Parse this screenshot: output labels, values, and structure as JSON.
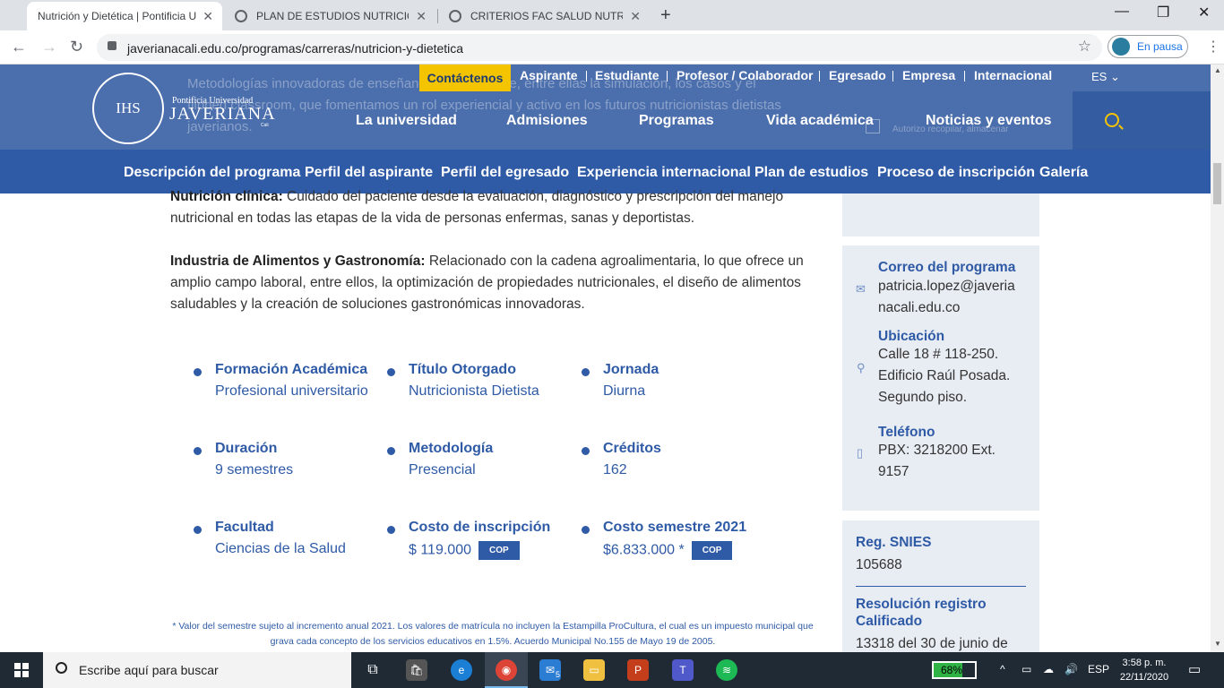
{
  "browser": {
    "tabs": [
      {
        "title": "Nutrición y Dietética | Pontificia U"
      },
      {
        "title": "PLAN DE ESTUDIOS NUTRICION"
      },
      {
        "title": "CRITERIOS FAC SALUD NUTRICIO"
      }
    ],
    "url": "javerianacali.edu.co/programas/carreras/nutricion-y-dietetica",
    "profile_label": "En pausa"
  },
  "header": {
    "ghost_text": "Metodologías innovadoras de enseñanza y aprendizaje, entre ellas la simulación, los casos y el flipped classroom, que fomentamos un rol experiencial y activo en los futuros nutricionistas dietistas javerianos.",
    "logo": {
      "line1": "Pontificia Universidad",
      "line2": "JAVERIANA",
      "line3": "Cali",
      "seal": "IHS"
    },
    "contact_label": "Contáctenos",
    "top_links": [
      "Aspirante",
      "Estudiante",
      "Profesor / Colaborador",
      "Egresado",
      "Empresa",
      "Internacional"
    ],
    "lang": "ES",
    "main_links": [
      "La universidad",
      "Admisiones",
      "Programas",
      "Vida académica",
      "Noticias y eventos"
    ],
    "ghost_check_label": "Autorizo recopilar, almacenar"
  },
  "subnav": [
    "Descripción del programa",
    "Perfil del aspirante",
    "Perfil del egresado",
    "Experiencia internacional",
    "Plan de estudios",
    "Proceso de inscripción",
    "Galería"
  ],
  "content": {
    "p1_bold": "Nutrición clínica:",
    "p1_text": " Cuidado del paciente desde la evaluación, diagnóstico y prescripción del manejo nutricional en todas las etapas de la vida de personas enfermas, sanas y deportistas.",
    "p2_bold": "Industria de Alimentos y Gastronomía:",
    "p2_text": " Relacionado con la cadena agroalimentaria, lo que ofrece un amplio campo laboral, entre ellos, la optimización de propiedades nutricionales, el diseño de alimentos saludables y la creación de soluciones gastronómicas innovadoras.",
    "info": [
      {
        "label": "Formación Académica",
        "value": "Profesional universitario"
      },
      {
        "label": "Título Otorgado",
        "value": "Nutricionista Dietista"
      },
      {
        "label": "Jornada",
        "value": "Diurna"
      },
      {
        "label": "Duración",
        "value": "9 semestres"
      },
      {
        "label": "Metodología",
        "value": "Presencial"
      },
      {
        "label": "Créditos",
        "value": "162"
      },
      {
        "label": "Facultad",
        "value": "Ciencias de la Salud"
      },
      {
        "label": "Costo de inscripción",
        "value": "$ 119.000",
        "badge": "COP"
      },
      {
        "label": "Costo semestre 2021",
        "value": "$6.833.000 *",
        "badge": "COP"
      }
    ],
    "footnote": "* Valor del semestre sujeto al incremento anual 2021. Los valores de matrícula no incluyen la Estampilla ProCultura, el cual es un impuesto municipal que grava cada concepto de los servicios educativos en 1.5%. Acuerdo Municipal No.155 de Mayo 19 de 2005."
  },
  "sidebar": {
    "email_label": "Correo del programa",
    "email_value_1": "patricia.lopez@javeria",
    "email_value_2": "nacali.edu.co",
    "location_label": "Ubicación",
    "location_1": "Calle 18 # 118-250.",
    "location_2": "Edificio Raúl Posada.",
    "location_3": "Segundo piso.",
    "phone_label": "Teléfono",
    "phone_1": "PBX: 3218200 Ext.",
    "phone_2": "9157",
    "snies_label": "Reg. SNIES",
    "snies_value": "105688",
    "resolution_label_1": "Resolución registro",
    "resolution_label_2": "Calificado",
    "resolution_value": "13318 del 30 de junio de"
  },
  "taskbar": {
    "search_placeholder": "Escribe aquí para buscar",
    "battery": "68%",
    "lang": "ESP",
    "time": "3:58 p. m.",
    "date": "22/11/2020",
    "mail_badge": "5"
  }
}
